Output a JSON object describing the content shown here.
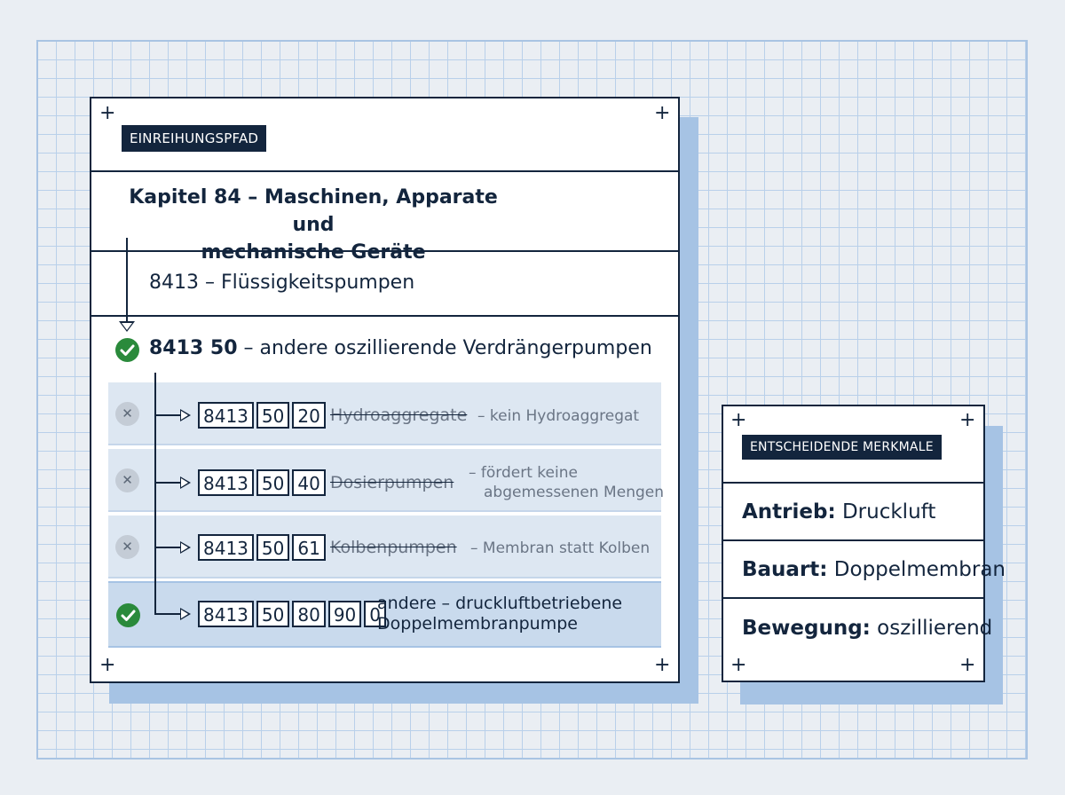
{
  "path": {
    "tag": "EINREIHUNGSPFAD",
    "chapter_line1": "Kapitel 84 – Maschinen, Apparate und",
    "chapter_line2": "mechanische Geräte",
    "heading": "8413 – Flüssigkeitspumpen",
    "subheading_code": "8413 50",
    "subheading_text": " – andere oszillierende Verdrängerpumpen",
    "rows": [
      {
        "status": "rejected",
        "codes": [
          "8413",
          "50",
          "20"
        ],
        "label": "Hydroaggregate",
        "reason1": "– kein Hydroaggregat",
        "reason2": ""
      },
      {
        "status": "rejected",
        "codes": [
          "8413",
          "50",
          "40"
        ],
        "label": "Dosierpumpen",
        "reason1": "– fördert keine",
        "reason2": "abgemessenen Mengen"
      },
      {
        "status": "rejected",
        "codes": [
          "8413",
          "50",
          "61"
        ],
        "label": "Kolbenpumpen",
        "reason1": "– Membran statt Kolben",
        "reason2": ""
      },
      {
        "status": "accepted",
        "codes": [
          "8413",
          "50",
          "80",
          "90",
          "0"
        ],
        "label1": "andere – druckluftbetriebene",
        "label2": "Doppelmembranpumpe"
      }
    ]
  },
  "features": {
    "tag": "ENTSCHEIDENDE MERKMALE",
    "items": [
      {
        "key": "Antrieb:",
        "value": " Druckluft"
      },
      {
        "key": "Bauart:",
        "value": " Doppelmembran"
      },
      {
        "key": "Bewegung:",
        "value": " oszillierend"
      }
    ]
  },
  "icons": {
    "accepted": "check-icon",
    "rejected": "x-icon",
    "corner": "plus-icon",
    "arrow": "arrow-icon"
  },
  "colors": {
    "navy": "#13253d",
    "green": "#2a8a3b",
    "accent_blue": "#a6c3e4",
    "row_bg": "#dde7f2"
  }
}
